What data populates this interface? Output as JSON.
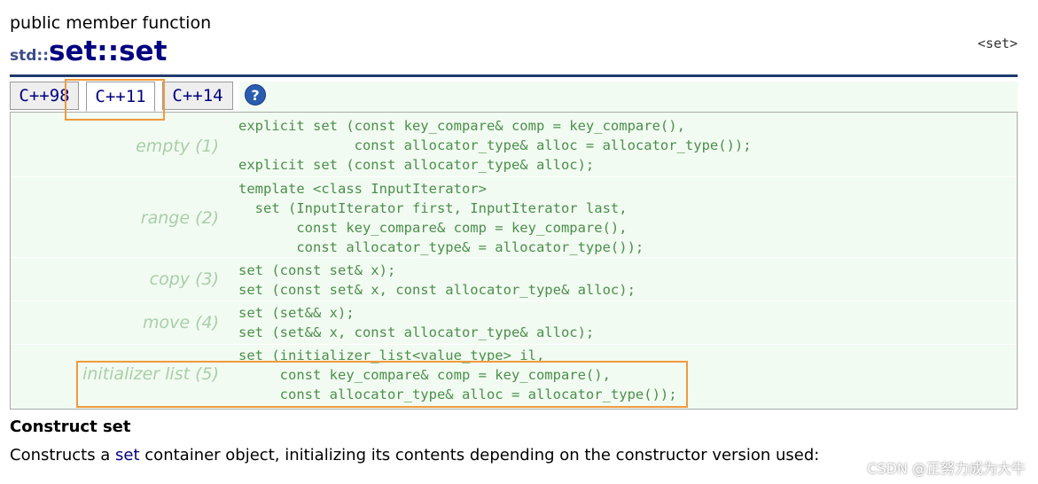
{
  "member_type": "public member function",
  "title": {
    "namespace": "std::",
    "name": "set::set"
  },
  "header_link": "<set>",
  "tabs": [
    {
      "label": "C++98",
      "active": false
    },
    {
      "label": "C++11",
      "active": true
    },
    {
      "label": "C++14",
      "active": false
    }
  ],
  "help_icon": {
    "symbol": "?",
    "color": "#2a5db0"
  },
  "constructors": [
    {
      "label": "empty (1)",
      "code": "explicit set (const key_compare& comp = key_compare(),\n              const allocator_type& alloc = allocator_type());\nexplicit set (const allocator_type& alloc);"
    },
    {
      "label": "range (2)",
      "code": "template <class InputIterator>\n  set (InputIterator first, InputIterator last,\n       const key_compare& comp = key_compare(),\n       const allocator_type& = allocator_type());"
    },
    {
      "label": "copy (3)",
      "code": "set (const set& x);\nset (const set& x, const allocator_type& alloc);"
    },
    {
      "label": "move (4)",
      "code": "set (set&& x);\nset (set&& x, const allocator_type& alloc);"
    },
    {
      "label": "initializer list (5)",
      "code": "set (initializer_list<value_type> il,\n     const key_compare& comp = key_compare(),\n     const allocator_type& alloc = allocator_type());"
    }
  ],
  "section_title": "Construct set",
  "description": {
    "before": "Constructs a ",
    "link": "set",
    "after": " container object, initializing its contents depending on the constructor version used:"
  },
  "watermark": "CSDN @正努力成为大牛",
  "colors": {
    "accent": "#000080",
    "highlight": "#f09a3e",
    "code": "#4a8f4a",
    "panel": "#f2fbf2"
  }
}
